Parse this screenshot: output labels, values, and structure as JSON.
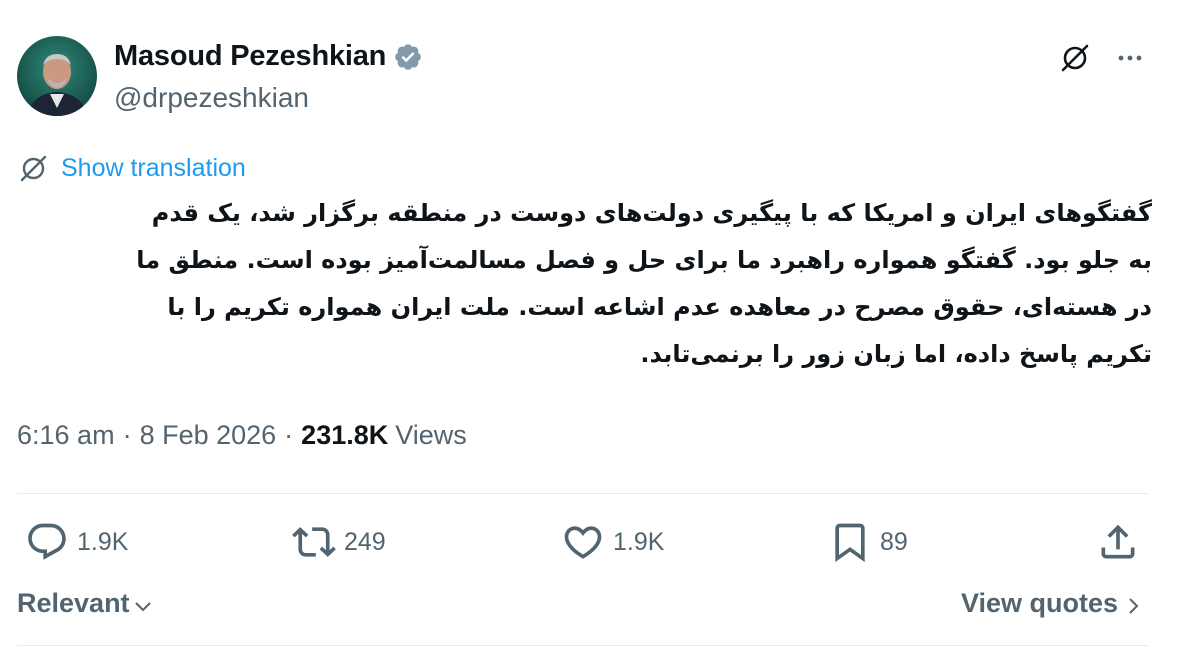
{
  "author": {
    "display_name": "Masoud Pezeshkian",
    "handle": "@drpezeshkian",
    "verified": true
  },
  "header_icons": [
    "grok-icon",
    "more-icon"
  ],
  "translate": {
    "label": "Show translation",
    "icon": "translate-icon"
  },
  "tweet": {
    "lines": [
      "گفتگوهای ایران و امریکا که با پیگیری دولت‌های دوست در منطقه برگزار شد، یک قدم",
      "به جلو بود. گفتگو همواره راهبرد ما برای حل و فصل مسالمت‌آمیز بوده است. منطق ما",
      "در هسته‌ای، حقوق مصرح در معاهده عدم اشاعه است. ملت ایران همواره تکریم را با",
      "تکریم پاسخ داده، اما زبان زور را برنمی‌تابد."
    ]
  },
  "meta": {
    "time": "6:16 am",
    "separator": "·",
    "date": "8 Feb 2026",
    "views_count": "231.8K",
    "views_label": "Views"
  },
  "actions": {
    "reply": {
      "icon": "reply-icon",
      "count": "1.9K"
    },
    "repost": {
      "icon": "repost-icon",
      "count": "249"
    },
    "like": {
      "icon": "heart-icon",
      "count": "1.9K"
    },
    "bookmark": {
      "icon": "bookmark-icon",
      "count": "89"
    },
    "share": {
      "icon": "share-icon"
    }
  },
  "footer": {
    "sort_label": "Relevant",
    "quotes_label": "View quotes"
  },
  "colors": {
    "link": "#1d9bf0",
    "verified": "#829aab",
    "secondary_text": "#536471",
    "primary_text": "#0f1419",
    "divider": "#e6ecf0"
  }
}
